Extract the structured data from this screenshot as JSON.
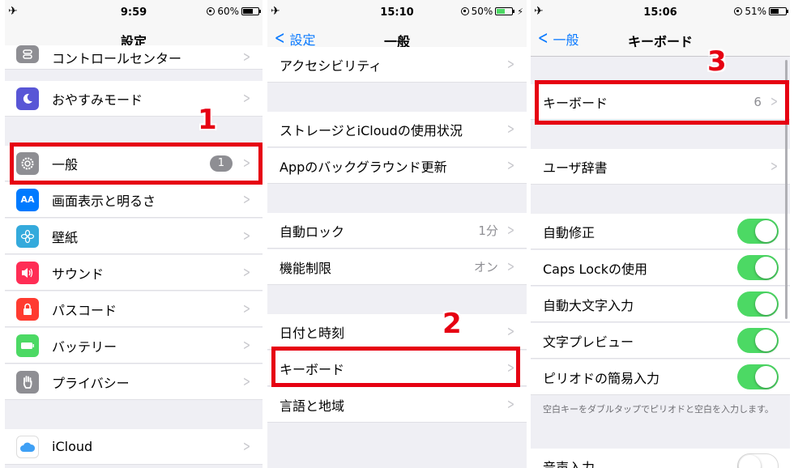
{
  "screens": [
    {
      "time": "9:59",
      "battery_text": "60%",
      "battery_level": 0.6,
      "nav_title": "設定",
      "back_label": "",
      "rows": [
        {
          "label": "コントロールセンター",
          "icon": "control-center-icon",
          "icon_color": "#8e8e93"
        },
        {
          "label": "おやすみモード",
          "icon": "moon-icon",
          "icon_color": "#5856d6"
        },
        {
          "label": "一般",
          "icon": "gear-icon",
          "icon_color": "#8e8e93",
          "badge": "1"
        },
        {
          "label": "画面表示と明るさ",
          "icon": "display-brightness-icon",
          "icon_color": "#007aff",
          "icon_text": "AA"
        },
        {
          "label": "壁紙",
          "icon": "wallpaper-icon",
          "icon_color": "#34aadc"
        },
        {
          "label": "サウンド",
          "icon": "speaker-icon",
          "icon_color": "#ff2d55"
        },
        {
          "label": "パスコード",
          "icon": "lock-icon",
          "icon_color": "#ff3b30"
        },
        {
          "label": "バッテリー",
          "icon": "battery-icon",
          "icon_color": "#4cd964"
        },
        {
          "label": "プライバシー",
          "icon": "hand-icon",
          "icon_color": "#8e8e93"
        },
        {
          "label": "iCloud",
          "icon": "cloud-icon",
          "icon_color": "#ffffff"
        }
      ],
      "step": "1"
    },
    {
      "time": "15:10",
      "battery_text": "50%",
      "battery_level": 0.5,
      "nav_title": "一般",
      "back_label": "設定",
      "rows": [
        {
          "label": "アクセシビリティ"
        },
        {
          "label": "ストレージとiCloudの使用状況"
        },
        {
          "label": "Appのバックグラウンド更新"
        },
        {
          "label": "自動ロック",
          "value": "1分"
        },
        {
          "label": "機能制限",
          "value": "オン"
        },
        {
          "label": "日付と時刻"
        },
        {
          "label": "キーボード"
        },
        {
          "label": "言語と地域"
        }
      ],
      "step": "2"
    },
    {
      "time": "15:06",
      "battery_text": "51%",
      "battery_level": 0.51,
      "nav_title": "キーボード",
      "back_label": "一般",
      "rows": [
        {
          "label": "キーボード",
          "value": "6"
        },
        {
          "label": "ユーザ辞書"
        },
        {
          "label": "自動修正",
          "toggle": true
        },
        {
          "label": "Caps Lockの使用",
          "toggle": true
        },
        {
          "label": "自動大文字入力",
          "toggle": true
        },
        {
          "label": "文字プレビュー",
          "toggle": true
        },
        {
          "label": "ピリオドの簡易入力",
          "toggle": true
        },
        {
          "label": "音声入力",
          "toggle": false
        }
      ],
      "footnote": "空白キーをダブルタップでピリオドと空白を入力します。",
      "step": "3"
    }
  ]
}
